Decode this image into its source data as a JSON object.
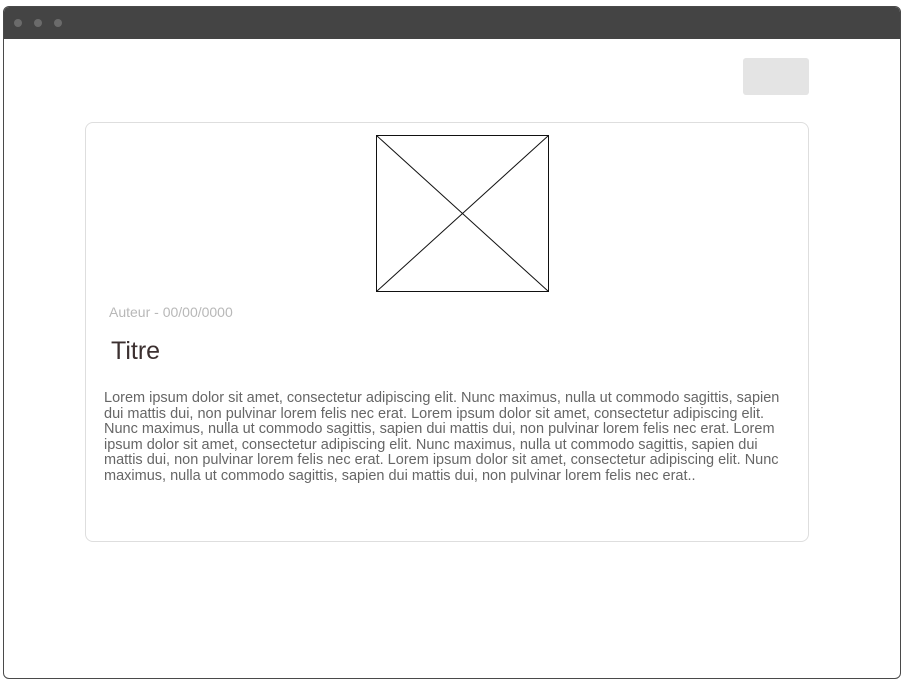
{
  "window": {
    "controls": [
      "close-dot",
      "minimize-dot",
      "maximize-dot"
    ]
  },
  "header": {
    "theme_toggle_icon": "moon-icon"
  },
  "article": {
    "image_icon": "image-placeholder-icon",
    "meta": "Auteur - 00/00/0000",
    "title": "Titre",
    "body": "Lorem ipsum dolor sit amet, consectetur adipiscing elit. Nunc maximus, nulla ut commodo sagittis, sapien dui mattis dui, non pulvinar lorem felis nec erat. Lorem ipsum dolor sit amet, consectetur adipiscing elit. Nunc maximus, nulla ut commodo sagittis, sapien dui mattis dui, non pulvinar lorem felis nec erat. Lorem ipsum dolor sit amet, consectetur adipiscing elit. Nunc maximus, nulla ut commodo sagittis, sapien dui mattis dui, non pulvinar lorem felis nec erat. Lorem ipsum dolor sit amet, consectetur adipiscing elit. Nunc maximus, nulla ut commodo sagittis, sapien dui mattis dui, non pulvinar lorem felis nec erat.."
  },
  "colors": {
    "titlebar": "#444444",
    "toggle_bg": "#e4e4e4",
    "meta_text": "#b8b8b8",
    "title_text": "#3c3030",
    "body_text": "#666666"
  }
}
